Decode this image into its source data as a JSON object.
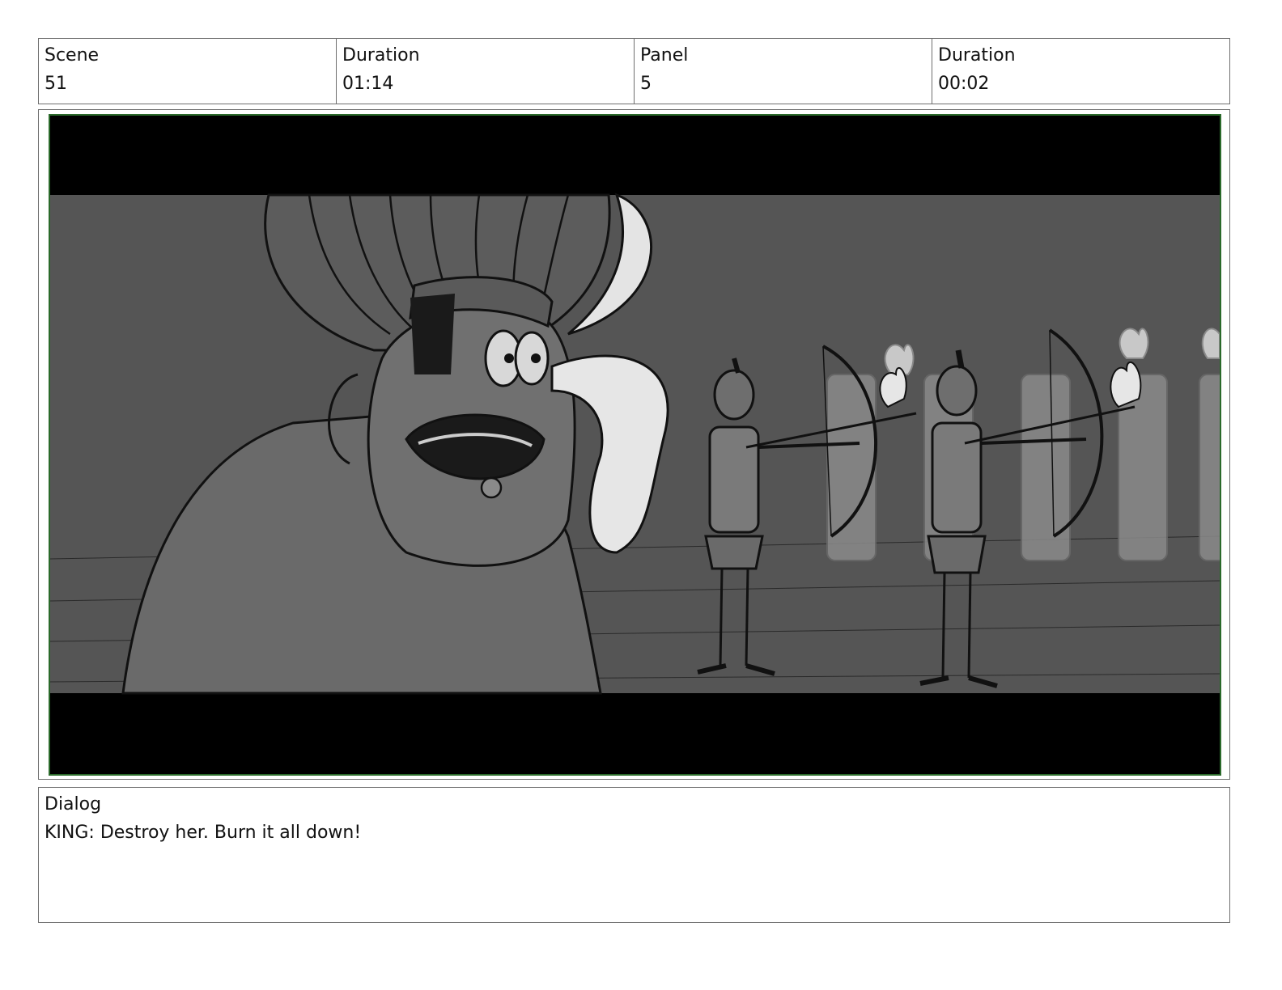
{
  "header": {
    "scene_label": "Scene",
    "scene_value": "51",
    "scene_duration_label": "Duration",
    "scene_duration_value": "01:14",
    "panel_label": "Panel",
    "panel_value": "5",
    "panel_duration_label": "Duration",
    "panel_duration_value": "00:02"
  },
  "dialog": {
    "label": "Dialog",
    "text": "KING: Destroy her. Burn it all down!"
  },
  "colors": {
    "panel_border": "#2b6a2b",
    "cell_border": "#6f6f6f",
    "letterbox": "#000000",
    "sketch_bg": "#555555"
  }
}
